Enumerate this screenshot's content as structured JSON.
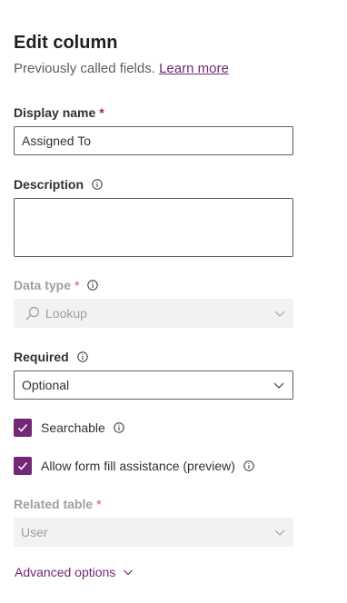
{
  "header": {
    "title": "Edit column",
    "subtitle": "Previously called fields.",
    "learn_more": "Learn more"
  },
  "display_name": {
    "label": "Display name",
    "required_mark": "*",
    "value": "Assigned To"
  },
  "description": {
    "label": "Description",
    "value": ""
  },
  "data_type": {
    "label": "Data type",
    "required_mark": "*",
    "value": "Lookup",
    "icon": "search-icon"
  },
  "required": {
    "label": "Required",
    "value": "Optional"
  },
  "searchable": {
    "label": "Searchable",
    "checked": true
  },
  "form_fill": {
    "label": "Allow form fill assistance (preview)",
    "checked": true
  },
  "related_table": {
    "label": "Related table",
    "required_mark": "*",
    "value": "User"
  },
  "advanced": {
    "label": "Advanced options"
  },
  "colors": {
    "accent": "#742774",
    "required": "#a4262c",
    "disabled_bg": "#f3f2f1",
    "disabled_text": "#a19f9d"
  }
}
